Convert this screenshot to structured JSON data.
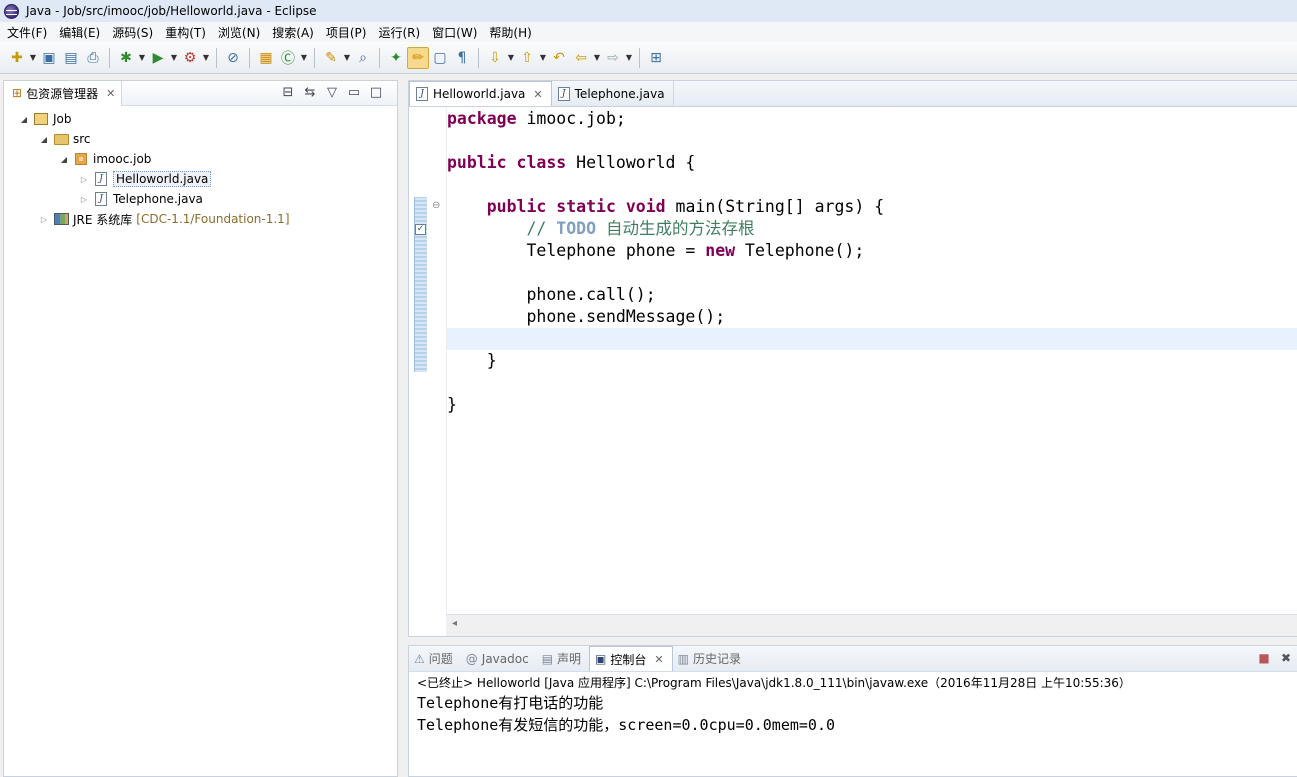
{
  "window": {
    "title": "Java  - Job/src/imooc/job/Helloworld.java - Eclipse"
  },
  "menu": {
    "items": [
      "文件(F)",
      "编辑(E)",
      "源码(S)",
      "重构(T)",
      "浏览(N)",
      "搜索(A)",
      "项目(P)",
      "运行(R)",
      "窗口(W)",
      "帮助(H)"
    ]
  },
  "package_explorer": {
    "tab_label": "包资源管理器",
    "project": "Job",
    "src_folder": "src",
    "package": "imooc.job",
    "files": [
      "Helloworld.java",
      "Telephone.java"
    ],
    "jre_label": "JRE 系统库",
    "jre_version": "[CDC-1.1/Foundation-1.1]"
  },
  "editor": {
    "tabs": [
      "Helloworld.java",
      "Telephone.java"
    ],
    "code": {
      "line1_kw": "package",
      "line1_rest": " imooc.job;",
      "line3_kw1": "public",
      "line3_kw2": "class",
      "line3_rest": " Helloworld {",
      "line5_kw1": "public",
      "line5_kw2": "static",
      "line5_kw3": "void",
      "line5_rest": " main(String[] args) {",
      "line6_comment_prefix": "// ",
      "line6_todo": "TODO",
      "line6_comment_rest": " 自动生成的方法存根",
      "line7_before": "Telephone phone = ",
      "line7_kw": "new",
      "line7_after": " Telephone();",
      "line9": "phone.call();",
      "line10": "phone.sendMessage();",
      "line12": "}",
      "line14": "}"
    }
  },
  "console": {
    "tabs": [
      "问题",
      "Javadoc",
      "声明",
      "控制台",
      "历史记录"
    ],
    "active_tab": "控制台",
    "header": "<已终止> Helloworld [Java 应用程序] C:\\Program Files\\Java\\jdk1.8.0_111\\bin\\javaw.exe（2016年11月28日 上午10:55:36）",
    "output": [
      "Telephone有打电话的功能",
      "Telephone有发短信的功能，screen=0.0cpu=0.0mem=0.0"
    ]
  }
}
